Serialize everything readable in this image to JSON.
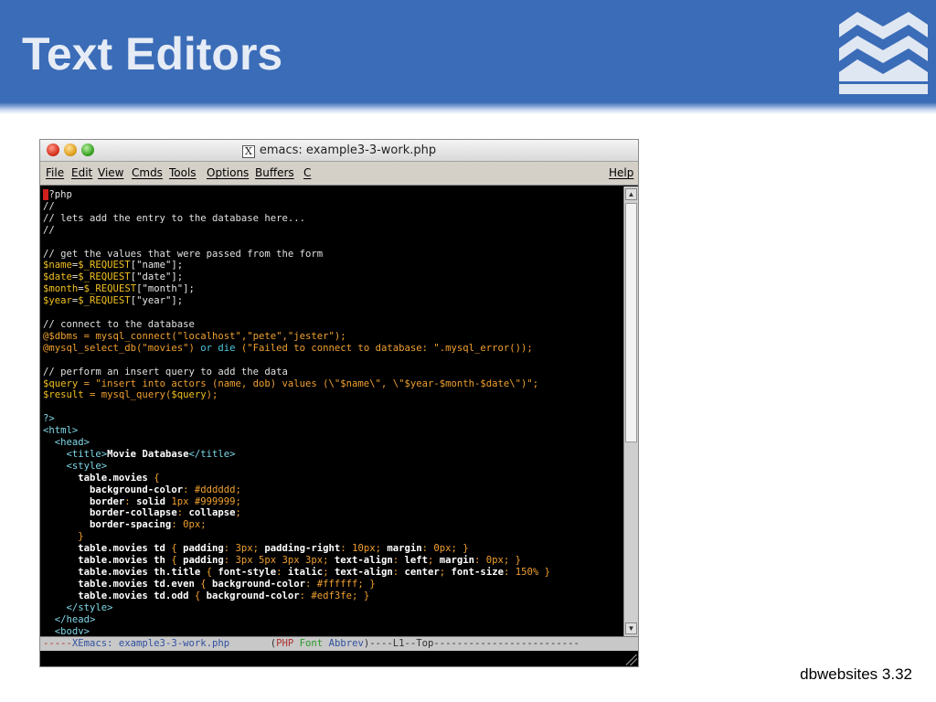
{
  "slide": {
    "title": "Text Editors",
    "footer": "dbwebsites 3.32"
  },
  "window": {
    "title": "emacs: example3-3-work.php"
  },
  "menu": {
    "file": "File",
    "edit": "Edit",
    "view": "View",
    "cmds": "Cmds",
    "tools": "Tools",
    "options": "Options",
    "buffers": "Buffers",
    "c": "C",
    "help": "Help"
  },
  "code": {
    "l01": "?php",
    "l02": "//",
    "l03": "// lets add the entry to the database here...",
    "l04": "//",
    "l06": "// get the values that were passed from the form",
    "l07a": "$name",
    "l07b": "=",
    "l07c": "$_REQUEST",
    "l07d": "[\"name\"];",
    "l08a": "$date",
    "l08b": "=",
    "l08c": "$_REQUEST",
    "l08d": "[\"date\"];",
    "l09a": "$month",
    "l09b": "=",
    "l09c": "$_REQUEST",
    "l09d": "[\"month\"];",
    "l10a": "$year",
    "l10b": "=",
    "l10c": "$_REQUEST",
    "l10d": "[\"year\"];",
    "l12": "// connect to the database",
    "l13a": "@$dbms",
    "l13b": " = mysql_connect(\"localhost\",\"pete\",\"jester\");",
    "l14a": "@mysql_select_db(\"movies\") ",
    "l14b": "or die",
    "l14c": " (\"Failed to connect to database: \".mysql_error());",
    "l16": "// perform an insert query to add the data",
    "l17a": "$query",
    "l17b": " = \"insert into actors (name, dob) values (\\\"$name\\\", \\\"$year-$month-$date\\\")\";",
    "l18a": "$result",
    "l18b": " = mysql_query(",
    "l18c": "$query",
    "l18d": ");",
    "l20": "?>",
    "l21": "<html>",
    "l22": "  <head>",
    "l23a": "    <title>",
    "l23b": "Movie Database",
    "l23c": "</title>",
    "l24": "    <style>",
    "l25a": "      table.movies",
    "l25b": " {",
    "l26a": "        background-color",
    "l26b": ": #dddddd;",
    "l27a": "        border",
    "l27b": ": ",
    "l27c": "solid",
    "l27d": " 1px",
    "l27e": " #999999;",
    "l28a": "        border-collapse",
    "l28b": ": ",
    "l28c": "collapse",
    "l28d": ";",
    "l29a": "        border-spacing",
    "l29b": ": ",
    "l29c": "0px",
    "l29d": ";",
    "l30": "      }",
    "l31a": "      table.movies td",
    "l31b": " { ",
    "l31c": "padding",
    "l31d": ": 3px; ",
    "l31e": "padding-right",
    "l31f": ": 10px; ",
    "l31g": "margin",
    "l31h": ": 0px; }",
    "l32a": "      table.movies th",
    "l32b": " { ",
    "l32c": "padding",
    "l32d": ": 3px 5px 3px 3px; ",
    "l32e": "text-align",
    "l32f": ": ",
    "l32g": "left",
    "l32h": "; ",
    "l32i": "margin",
    "l32j": ": 0px; }",
    "l33a": "      table.movies th.title",
    "l33b": " { ",
    "l33c": "font-style",
    "l33d": ": ",
    "l33e": "italic",
    "l33f": "; ",
    "l33g": "text-align",
    "l33h": ": ",
    "l33i": "center",
    "l33j": "; ",
    "l33k": "font-size",
    "l33l": ": 150% }",
    "l34a": "      table.movies td.even",
    "l34b": " { ",
    "l34c": "background-color",
    "l34d": ": #ffffff; }",
    "l35a": "      table.movies td.odd",
    "l35b": " { ",
    "l35c": "background-color",
    "l35d": ": #edf3fe; }",
    "l36": "    </style>",
    "l37": "  </head>",
    "l38": "  <body>"
  },
  "modeline": {
    "dashes_left": "-----",
    "buffer": "XEmacs: example3-3-work.php",
    "gap": "       ",
    "open": "(",
    "php": "PHP",
    "font": " Font",
    "abbrev": " Abbrev",
    "close": ")----L1--Top-------------------------"
  },
  "colors": {
    "slide_band": "#3b6cb7",
    "title_text": "#e6ecf6",
    "php_var": "#f0c020",
    "php_keyword": "#4fc8e0",
    "html_tag": "#7fd8e8"
  },
  "icons": {
    "x_window": "x11-icon",
    "logo": "waves-logo"
  }
}
